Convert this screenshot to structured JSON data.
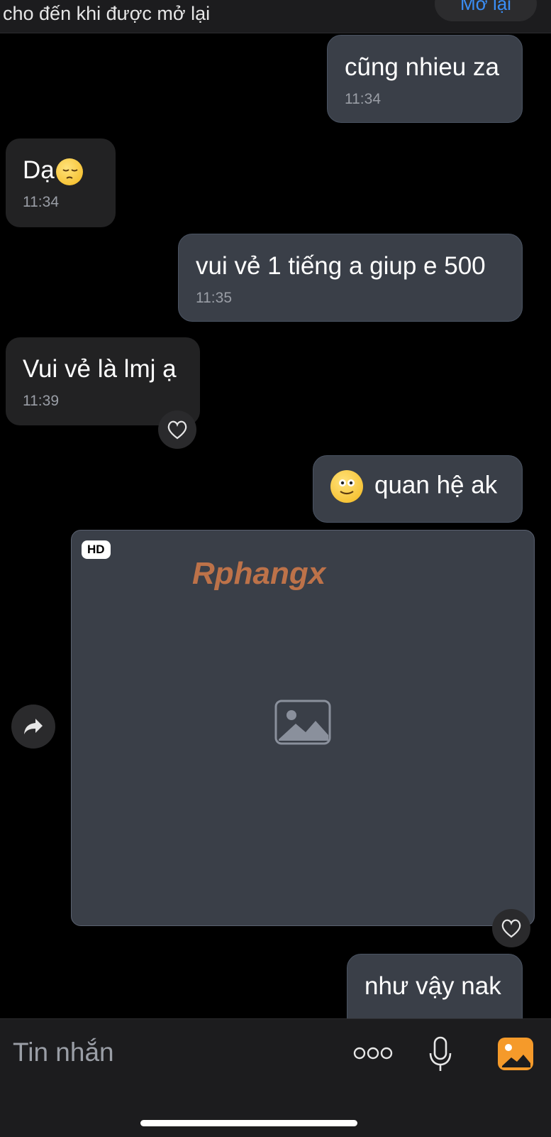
{
  "banner": {
    "notice": "cho đến khi được mở lại",
    "reopen_label": "Mở lại"
  },
  "messages": [
    {
      "direction": "outgoing",
      "text": "cũng nhieu za",
      "time": "11:34"
    },
    {
      "direction": "incoming",
      "text": "Dạ",
      "emoji": "pensive-face-emoji",
      "time": "11:34"
    },
    {
      "direction": "outgoing",
      "text": "vui vẻ 1 tiếng a giup e 500",
      "time": "11:35"
    },
    {
      "direction": "incoming",
      "text": "Vui vẻ là lmj ạ",
      "time": "11:39",
      "reaction": "heart-icon"
    },
    {
      "direction": "outgoing",
      "emoji": "smiling-face-emoji",
      "text": "quan hệ ak"
    },
    {
      "direction": "outgoing",
      "type": "image",
      "badge": "HD",
      "watermark": "Rphangx",
      "reaction": "heart-icon",
      "side_action": "forward-icon"
    },
    {
      "direction": "outgoing",
      "text": "như vậy nak"
    }
  ],
  "composer": {
    "placeholder": "Tin nhắn",
    "icons": [
      "more-icon",
      "microphone-icon",
      "gallery-icon"
    ]
  },
  "colors": {
    "background": "#000000",
    "outgoing_bubble": "#3a3f48",
    "incoming_bubble": "#222223",
    "accent": "#3a8ef6",
    "gallery_button": "#f59a2a"
  }
}
